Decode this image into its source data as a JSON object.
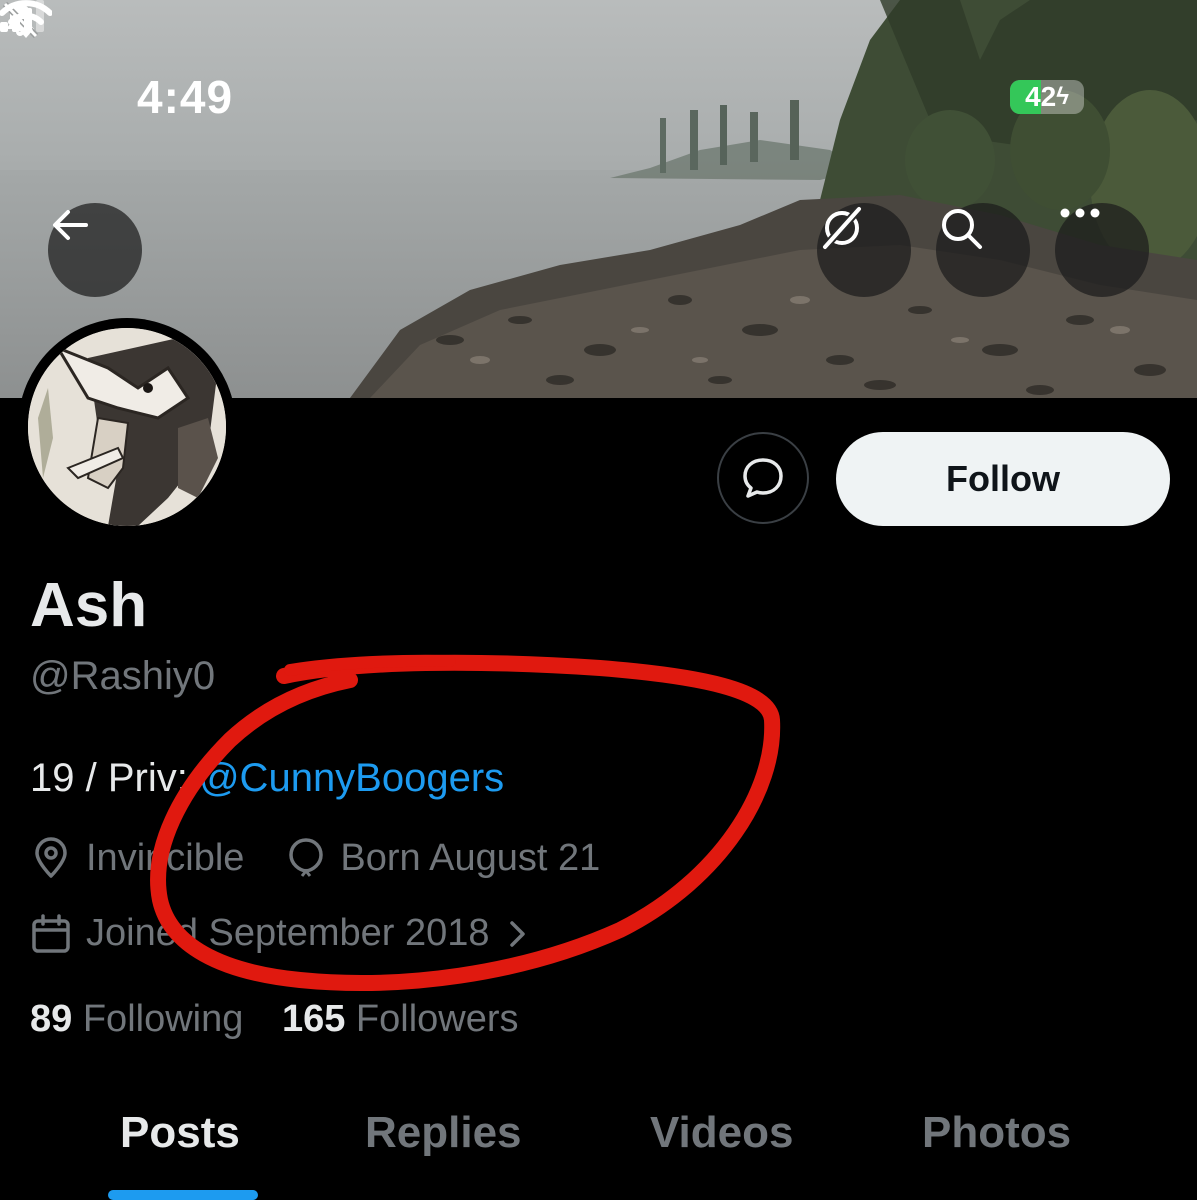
{
  "status_bar": {
    "time": "4:49",
    "battery_level": "42",
    "battery_fraction": 0.42
  },
  "header_buttons": {
    "back": "arrow-left-icon",
    "grok": "grok-icon",
    "search": "search-icon",
    "more": "more-icon"
  },
  "profile": {
    "follow_label": "Follow",
    "display_name": "Ash",
    "handle": "@Rashiy0",
    "bio_prefix": "19 / Priv: ",
    "bio_mention": "@CunnyBoogers",
    "location": "Invincible",
    "birthday": "Born August 21",
    "joined": "Joined September 2018",
    "following_count": "89",
    "following_label": "Following",
    "followers_count": "165",
    "followers_label": "Followers"
  },
  "tabs": [
    {
      "label": "Posts",
      "active": true
    },
    {
      "label": "Replies",
      "active": false
    },
    {
      "label": "Videos",
      "active": false
    },
    {
      "label": "Photos",
      "active": false
    }
  ],
  "colors": {
    "accent": "#1d9bf0",
    "annotation": "#e0190f",
    "battery": "#34c759"
  }
}
